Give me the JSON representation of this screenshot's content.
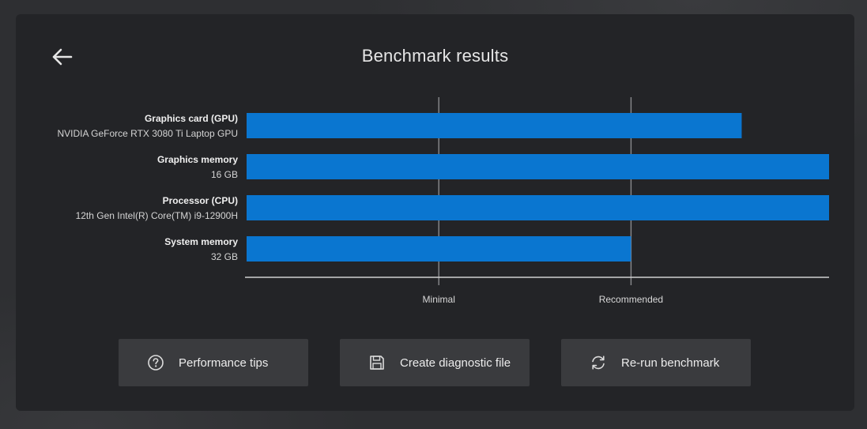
{
  "header": {
    "title": "Benchmark results"
  },
  "chart_data": {
    "type": "bar",
    "orientation": "horizontal",
    "categories": [
      {
        "label": "Graphics card (GPU)",
        "detail": "NVIDIA GeForce RTX 3080 Ti Laptop GPU"
      },
      {
        "label": "Graphics memory",
        "detail": "16 GB"
      },
      {
        "label": "Processor (CPU)",
        "detail": "12th Gen Intel(R) Core(TM) i9-12900H"
      },
      {
        "label": "System memory",
        "detail": "32 GB"
      }
    ],
    "values": [
      0.85,
      1.0,
      1.0,
      0.66
    ],
    "xlim": [
      0,
      1
    ],
    "reference_lines": [
      {
        "label": "Minimal",
        "value": 0.33
      },
      {
        "label": "Recommended",
        "value": 0.66
      }
    ],
    "bar_color": "#0a76d0",
    "grid": false,
    "legend": "none"
  },
  "actions": {
    "tips_label": "Performance tips",
    "diagnostic_label": "Create diagnostic file",
    "rerun_label": "Re-run benchmark"
  },
  "icons": {
    "back": "arrow-left-icon",
    "tips": "question-circle-icon",
    "diagnostic": "floppy-disk-icon",
    "rerun": "refresh-icon"
  },
  "colors": {
    "panel_bg": "#232427",
    "button_bg": "#3a3b3e",
    "text": "#e6e6e6",
    "accent_bar": "#0a76d0"
  }
}
